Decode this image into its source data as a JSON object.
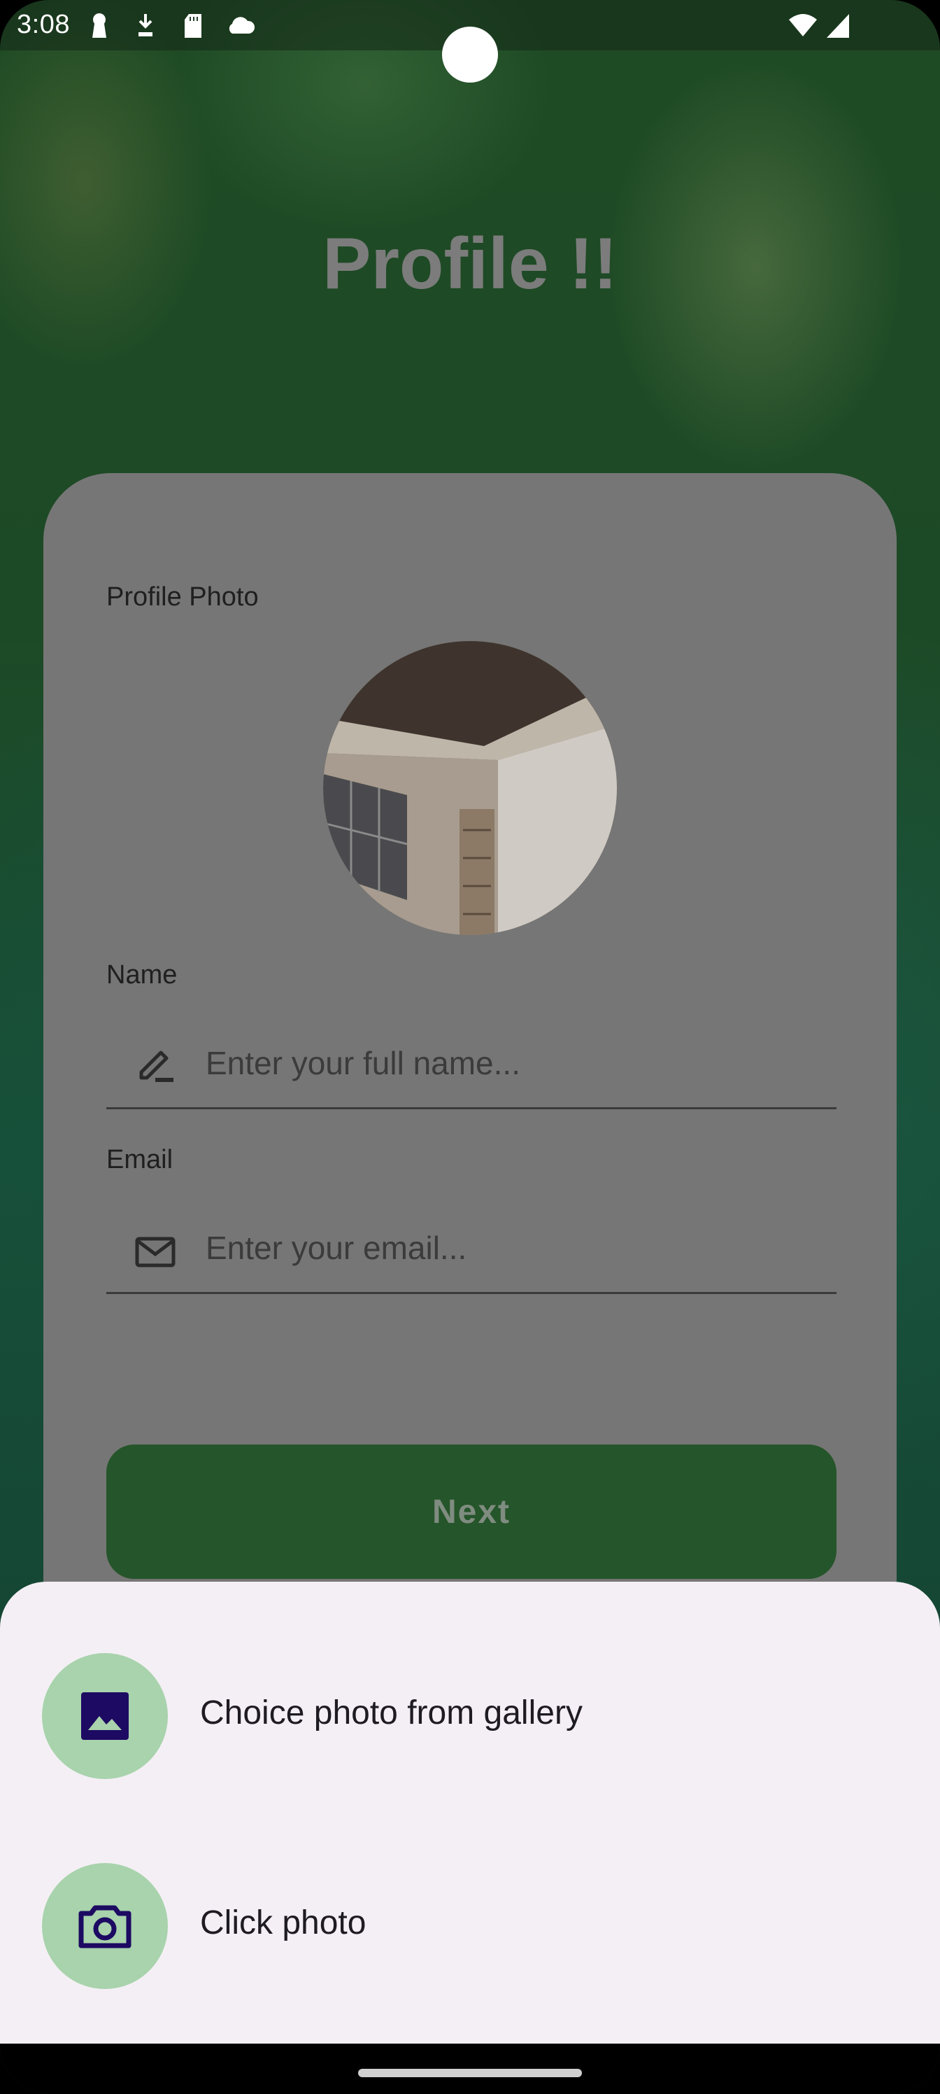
{
  "status_bar": {
    "time": "3:08"
  },
  "page": {
    "title": "Profile !!"
  },
  "form": {
    "photo_label": "Profile Photo",
    "name_label": "Name",
    "name_placeholder": "Enter your full name...",
    "email_label": "Email",
    "email_placeholder": "Enter your email...",
    "next_label": "Next"
  },
  "bottom_sheet": {
    "options": [
      {
        "label": "Choice photo from gallery",
        "icon": "image-icon"
      },
      {
        "label": "Click photo",
        "icon": "camera-icon"
      }
    ]
  },
  "colors": {
    "accent_green": "#25552a",
    "sheet_background": "#f4eff5",
    "icon_circle": "#a8d3ac",
    "icon_color": "#1d0a62"
  }
}
